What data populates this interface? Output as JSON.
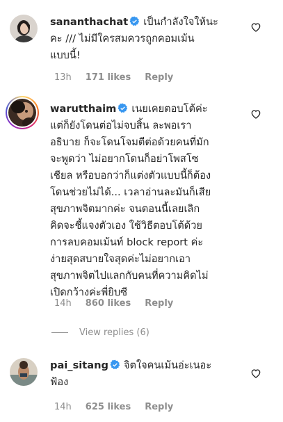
{
  "comments": [
    {
      "username": "sananthachat",
      "lines": [
        "เป็นกำลังใจให้นะ",
        "คะ /// ไม่มีใครสมควรถูกคอมเม้น",
        "แบบนี้!"
      ],
      "time": "13h",
      "likes": "171 likes",
      "reply": "Reply"
    },
    {
      "username": "warutthaim",
      "lines": [
        "เนยเคยตอบโต้ค่ะ",
        "แต่ก็ยังโดนต่อไม่จบสิ้น ละพอเรา",
        "อธิบาย ก็จะโดนโจมตีต่อด้วยคนที่มัก",
        "จะพูดว่า ไม่อยากโดนก็อย่าโพสโซ",
        "เชียล หรือบอกว่าก็แต่งตัวแบบนี้ก็ต้อง",
        "โดนช่วยไม่ได้... เวลาอ่านละมันก็เสีย",
        "สุขภาพจิตมากค่ะ จนตอนนี้เลยเลิก",
        "คิดจะชี้แจงตัวเอง ใช้วิธีตอบโต้ด้วย",
        "การลบคอมเม้นท์ block report ค่ะ",
        "ง่ายสุดสบายใจสุดค่ะไม่อยากเอา",
        "สุขภาพจิตไปแลกกับคนที่ความคิดไม่",
        "เปิดกว้างค่ะพี่ยิบซี"
      ],
      "time": "14h",
      "likes": "860 likes",
      "reply": "Reply",
      "view_replies": "View replies (6)"
    },
    {
      "username": "pai_sitang",
      "lines": [
        "จิตใจคนเม้นอ่ะเนอะ",
        "ฟ้อง"
      ],
      "time": "14h",
      "likes": "625 likes",
      "reply": "Reply"
    }
  ],
  "icons": {
    "verified": "verified-badge-icon",
    "like": "heart-outline-icon"
  },
  "colors": {
    "verified": "#3897f0",
    "secondary_text": "#8e8e8e",
    "primary_text": "#262626"
  }
}
